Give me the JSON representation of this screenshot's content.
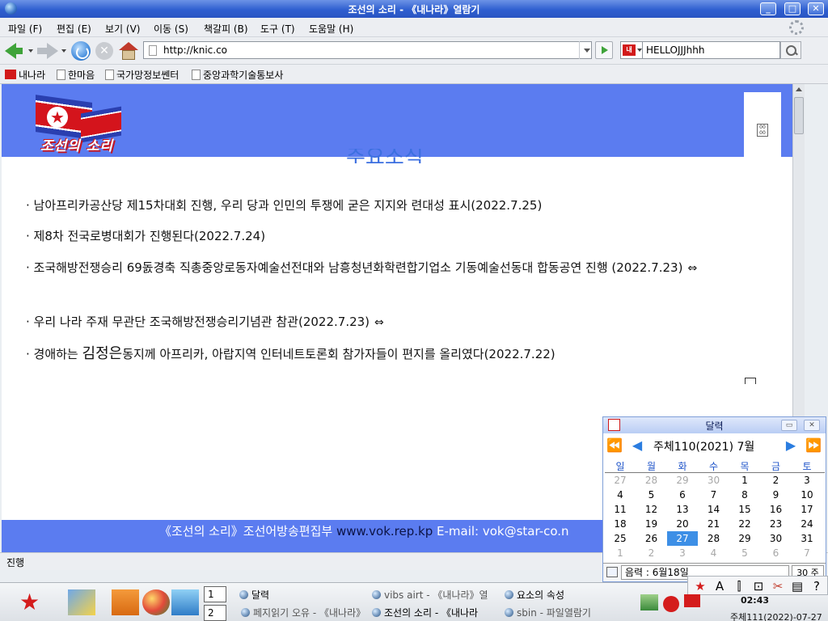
{
  "window": {
    "title": "조선의 소리 - 《내나라》열람기",
    "btn_min": "_",
    "btn_max": "□",
    "btn_close": "✕"
  },
  "menu": [
    "파일 (F)",
    "편집 (E)",
    "보기 (V)",
    "이동 (S)",
    "책갈피 (B)",
    "도구 (T)",
    "도움말 (H)"
  ],
  "toolbar": {
    "url": "http://knic.co",
    "search_value": "HELLOJJJhhh",
    "stop_glyph": "✕",
    "search_engine_logo": "내"
  },
  "bookmarks": [
    "내나라",
    "한마음",
    "국가망정보쎈터",
    "중앙과학기술통보사"
  ],
  "page": {
    "logo_text": "조선의 소리",
    "heading_partial": "주요소식",
    "grid_icon": "00 00",
    "headlines": [
      {
        "text": "· 남아프리카공산당 제15차대회 진행, 우리 당과 인민의 투쟁에 굳은 지지와 련대성 표시(2022.7.25)"
      },
      {
        "text": "· 제8차 전국로병대회가 진행된다(2022.7.24)"
      },
      {
        "text": "· 조국해방전쟁승리 69돐경축 직총중앙로동자예술선전대와 남흥청년화학련합기업소 기동예술선동대 합동공연 진행 (2022.7.23)",
        "icon": "⇔"
      },
      {
        "text": "· 우리 나라 주재 무관단 조국해방전쟁승리기념관 참관(2022.7.23)",
        "icon": "⇔"
      },
      {
        "pre": "· 경애하는 ",
        "big": "김정은",
        "post": "동지께 아프리카, 아랍지역 인터네트토론회 참가자들이 편지를 올리였다(2022.7.22)"
      }
    ],
    "footer": {
      "part1": "《조선의 소리》조선어방송편집부 ",
      "site": "www.vok.rep.kp",
      "part2": " E-mail: vok@star-co.n"
    }
  },
  "status_text": "진행",
  "calendar": {
    "title": "달력",
    "month_label": "주체110(2021)  7월",
    "weekdays": [
      "일",
      "월",
      "화",
      "수",
      "목",
      "금",
      "토"
    ],
    "days": [
      [
        "27",
        "28",
        "29",
        "30",
        "1",
        "2",
        "3"
      ],
      [
        "4",
        "5",
        "6",
        "7",
        "8",
        "9",
        "10"
      ],
      [
        "11",
        "12",
        "13",
        "14",
        "15",
        "16",
        "17"
      ],
      [
        "18",
        "19",
        "20",
        "21",
        "22",
        "23",
        "24"
      ],
      [
        "25",
        "26",
        "27",
        "28",
        "29",
        "30",
        "31"
      ],
      [
        "1",
        "2",
        "3",
        "4",
        "5",
        "6",
        "7"
      ]
    ],
    "selected_day": "27",
    "lunar": "음력 : 6월18일",
    "days_count": "30 주",
    "btn_restore": "▭",
    "btn_close": "✕",
    "nav_first": "⏪",
    "nav_prev": "◀",
    "nav_next": "▶",
    "nav_last": "⏩"
  },
  "taskbar": {
    "workspaces": [
      "1",
      "2"
    ],
    "tasks": [
      {
        "label": "달력"
      },
      {
        "label": "vibs airt - 《내나라》열"
      },
      {
        "label": "요소의 속성"
      },
      {
        "label": "페지읽기 오유 - 《내나라》"
      },
      {
        "label": "조선의 소리 - 《내나라"
      },
      {
        "label": "sbin - 파일열람기"
      }
    ],
    "ime_glyphs": [
      "A",
      "⫿",
      "⊡"
    ],
    "clock": "02:43",
    "date": "주체111(2022)-07-27"
  },
  "colors": {
    "banner": "#5b7cf0",
    "accent": "#3d8fe6",
    "title_bar": "#2f5fd0"
  }
}
